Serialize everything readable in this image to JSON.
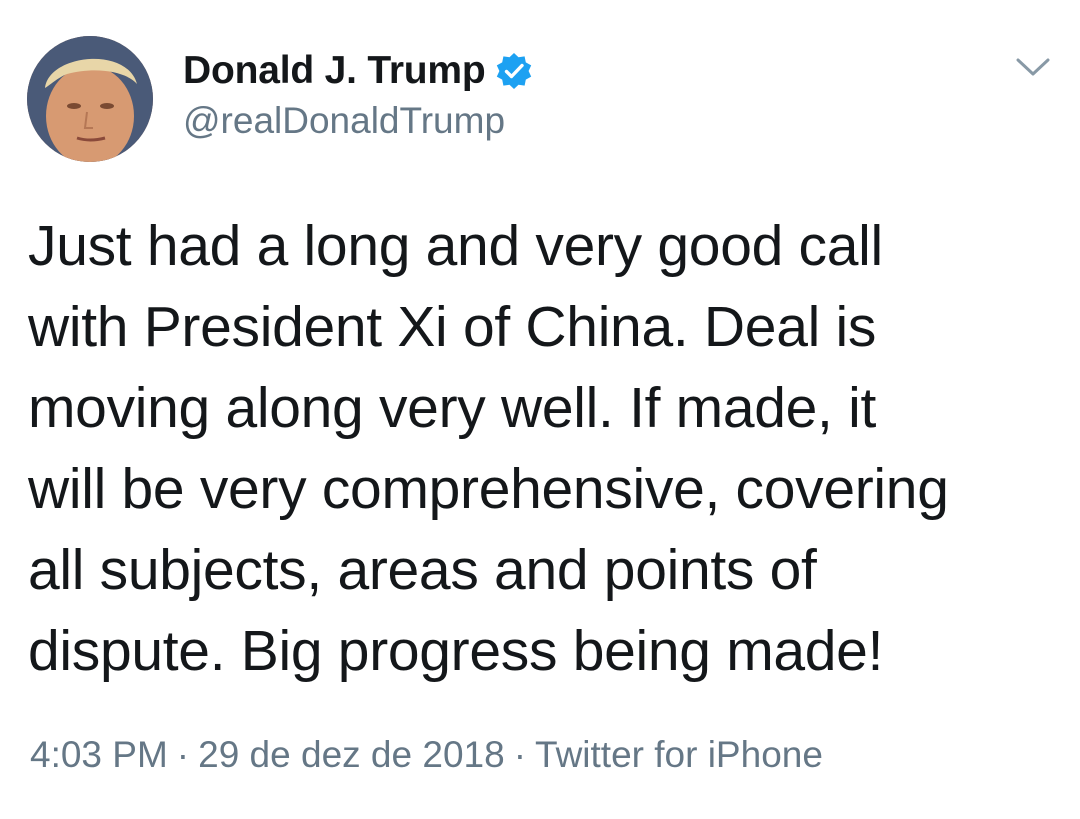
{
  "tweet": {
    "display_name": "Donald J. Trump",
    "handle": "@realDonaldTrump",
    "verified_icon": "verified-badge-icon",
    "menu_icon": "chevron-down-icon",
    "text_lines": [
      "Just had a long and very good call",
      "with President Xi of China. Deal is",
      "moving along very well. If made, it",
      "will be very comprehensive, covering",
      "all subjects, areas and points of",
      "dispute. Big progress being made!"
    ],
    "time": "4:03 PM",
    "separator": "·",
    "date": "29 de dez de 2018",
    "source": "Twitter for iPhone"
  },
  "colors": {
    "text": "#14171a",
    "secondary": "#657786",
    "verified": "#1da1f2",
    "background": "#ffffff"
  }
}
